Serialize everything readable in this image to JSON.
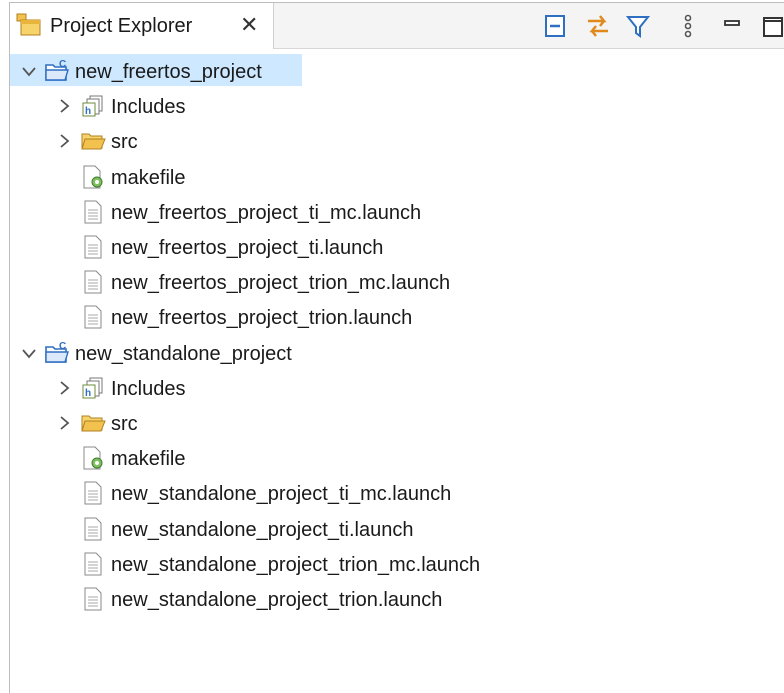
{
  "view": {
    "tab_label": "Project Explorer",
    "close_glyph": "✕",
    "toolbar": [
      {
        "name": "collapse-all-icon"
      },
      {
        "name": "link-with-editor-icon"
      },
      {
        "name": "filter-icon"
      },
      {
        "name": "view-menu-icon"
      },
      {
        "name": "minimize-icon"
      },
      {
        "name": "maximize-icon"
      }
    ]
  },
  "tree": {
    "projects": [
      {
        "label": "new_freertos_project",
        "expanded": true,
        "selected": true,
        "children": [
          {
            "label": "Includes",
            "type": "includes",
            "expandable": true
          },
          {
            "label": "src",
            "type": "folder",
            "expandable": true
          },
          {
            "label": "makefile",
            "type": "makefile",
            "expandable": false
          },
          {
            "label": "new_freertos_project_ti_mc.launch",
            "type": "file",
            "expandable": false
          },
          {
            "label": "new_freertos_project_ti.launch",
            "type": "file",
            "expandable": false
          },
          {
            "label": "new_freertos_project_trion_mc.launch",
            "type": "file",
            "expandable": false
          },
          {
            "label": "new_freertos_project_trion.launch",
            "type": "file",
            "expandable": false
          }
        ]
      },
      {
        "label": "new_standalone_project",
        "expanded": true,
        "selected": false,
        "children": [
          {
            "label": "Includes",
            "type": "includes",
            "expandable": true
          },
          {
            "label": "src",
            "type": "folder",
            "expandable": true
          },
          {
            "label": "makefile",
            "type": "makefile",
            "expandable": false
          },
          {
            "label": "new_standalone_project_ti_mc.launch",
            "type": "file",
            "expandable": false
          },
          {
            "label": "new_standalone_project_ti.launch",
            "type": "file",
            "expandable": false
          },
          {
            "label": "new_standalone_project_trion_mc.launch",
            "type": "file",
            "expandable": false
          },
          {
            "label": "new_standalone_project_trion.launch",
            "type": "file",
            "expandable": false
          }
        ]
      }
    ]
  },
  "colors": {
    "selection": "#cde8ff",
    "folder": "#f2c14e",
    "project_blue": "#2f6fc1"
  }
}
